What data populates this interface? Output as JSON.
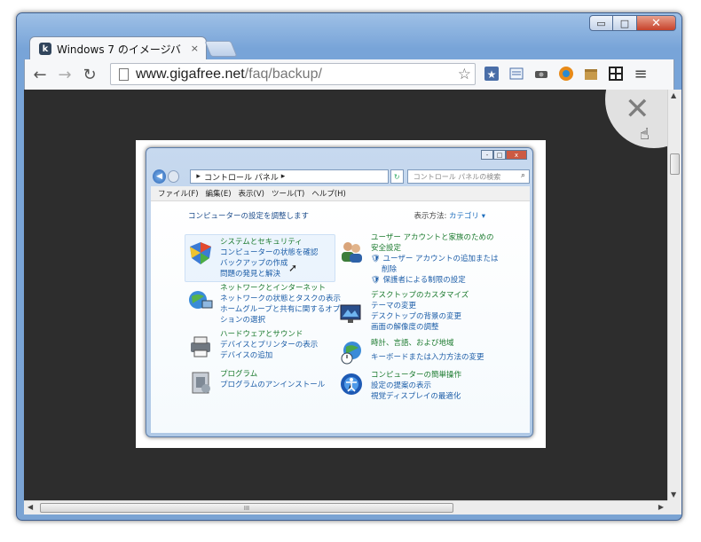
{
  "window": {
    "minimize": "▭",
    "maximize": "□",
    "close": "✕"
  },
  "tab": {
    "title": "Windows 7 のイメージバ",
    "close": "×",
    "favicon": "k"
  },
  "toolbar": {
    "back": "←",
    "forward": "→",
    "reload": "↻",
    "url_domain": "www.gigafree.net",
    "url_path": "/faq/backup/",
    "bookmark_star": "☆",
    "extension_icons": [
      "bookmark-manager-icon",
      "reader-icon",
      "camera-extension-icon",
      "gear-extension-icon",
      "package-extension-icon",
      "grid-extension-icon",
      "menu-icon"
    ],
    "menu": "≡"
  },
  "overlay": {
    "close_symbol": "✕"
  },
  "control_panel": {
    "breadcrumb": "コントロール パネル",
    "search_placeholder": "コントロール パネルの検索",
    "menu": [
      "ファイル(F)",
      "編集(E)",
      "表示(V)",
      "ツール(T)",
      "ヘルプ(H)"
    ],
    "heading": "コンピューターの設定を調整します",
    "view_label": "表示方法:",
    "view_value": "カテゴリ ▾",
    "left_categories": [
      {
        "title": "システムとセキュリティ",
        "links": [
          "コンピューターの状態を確認",
          "バックアップの作成",
          "問題の発見と解決"
        ]
      },
      {
        "title": "ネットワークとインターネット",
        "links": [
          "ネットワークの状態とタスクの表示",
          "ホームグループと共有に関するオプ",
          "ションの選択"
        ]
      },
      {
        "title": "ハードウェアとサウンド",
        "links": [
          "デバイスとプリンターの表示",
          "デバイスの追加"
        ]
      },
      {
        "title": "プログラム",
        "links": [
          "プログラムのアンインストール"
        ]
      }
    ],
    "right_categories": [
      {
        "title": "ユーザー アカウントと家族のための",
        "links": [
          "安全設定",
          "ユーザー アカウントの追加または",
          "削除",
          "保護者による制限の設定"
        ]
      },
      {
        "title": "デスクトップのカスタマイズ",
        "links": [
          "テーマの変更",
          "デスクトップの背景の変更",
          "画面の解像度の調整"
        ]
      },
      {
        "title": "時計、言語、および地域",
        "links": [
          "キーボードまたは入力方法の変更"
        ]
      },
      {
        "title": "コンピューターの簡単操作",
        "links": [
          "設定の提案の表示",
          "視覚ディスプレイの最適化"
        ]
      }
    ]
  },
  "scrollbar": {
    "grip": "III",
    "up": "▲",
    "down": "▼",
    "left": "◀",
    "right": "▶"
  }
}
